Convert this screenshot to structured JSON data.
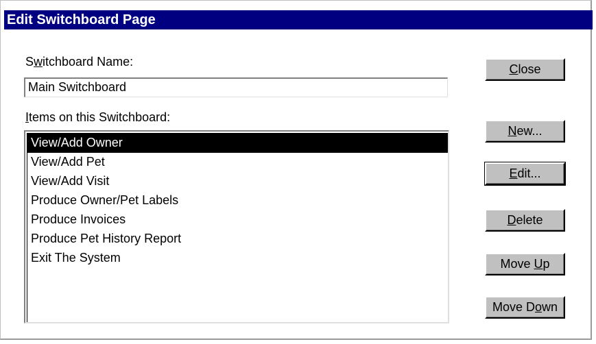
{
  "dialog": {
    "title": "Edit Switchboard Page",
    "name_label_pre": "S",
    "name_label_ul": "w",
    "name_label_post": "itchboard Name:",
    "name_value": "Main Switchboard",
    "items_label_ul": "I",
    "items_label_post": "tems on this Switchboard:",
    "items": [
      "View/Add Owner",
      "View/Add Pet",
      "View/Add Visit",
      "Produce Owner/Pet Labels",
      "Produce Invoices",
      "Produce Pet History Report",
      "Exit The System"
    ],
    "selected_index": 0
  },
  "buttons": {
    "close": {
      "ul": "C",
      "rest": "lose"
    },
    "new": {
      "ul": "N",
      "rest": "ew..."
    },
    "edit": {
      "ul": "E",
      "rest": "dit..."
    },
    "delete": {
      "ul": "D",
      "rest": "elete"
    },
    "move_up": {
      "pre": "Move ",
      "ul": "U",
      "rest": "p"
    },
    "move_down": {
      "pre": "Move D",
      "ul": "o",
      "rest": "wn"
    }
  },
  "colors": {
    "titlebar": "#000080",
    "button_face": "#c0c0c0",
    "selection": "#000000"
  }
}
